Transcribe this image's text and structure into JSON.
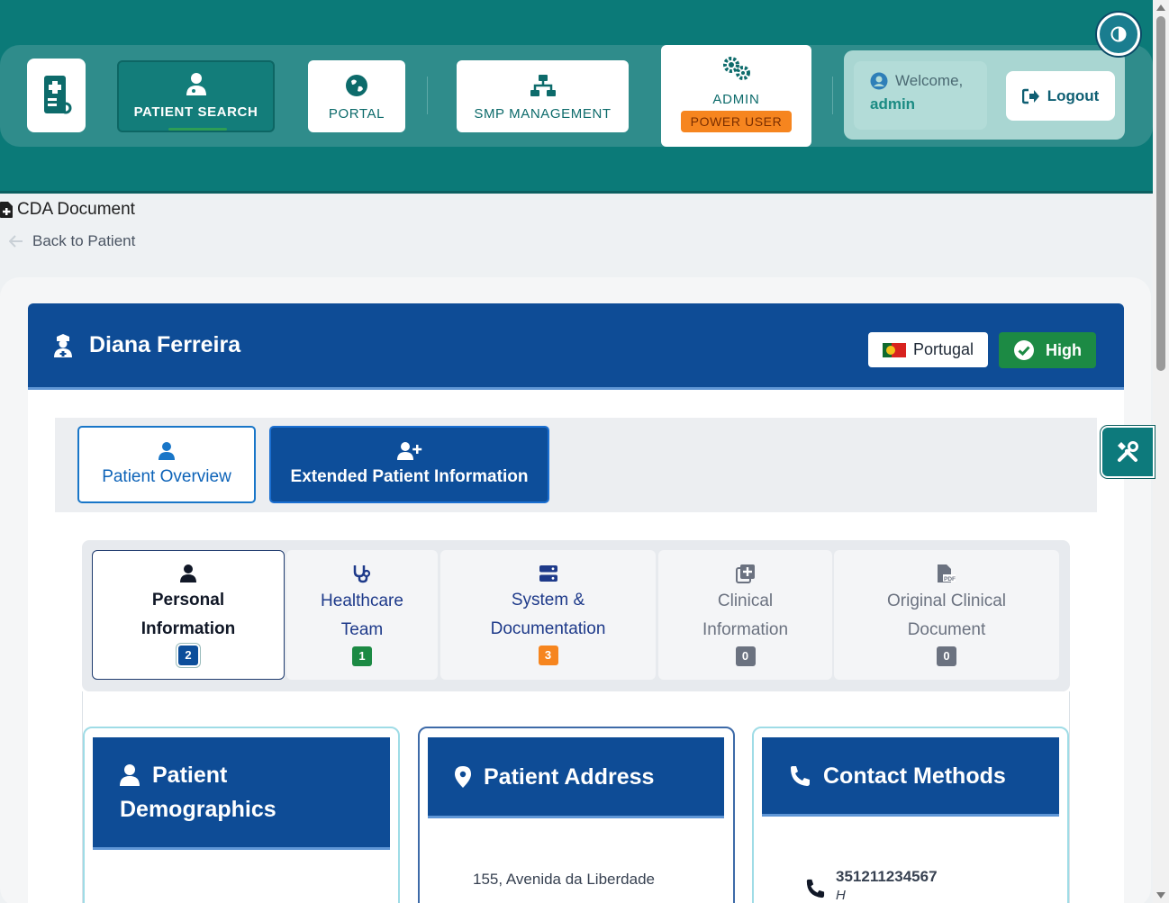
{
  "nav": {
    "logo_icon": "medical-file-icon",
    "items": [
      {
        "label": "PATIENT SEARCH",
        "icon": "user-doctor-icon"
      },
      {
        "label": "PORTAL",
        "icon": "globe-icon"
      },
      {
        "label": "SMP MANAGEMENT",
        "icon": "sitemap-icon"
      }
    ],
    "admin": {
      "label": "ADMIN",
      "role_badge": "POWER USER",
      "icon": "gears-icon"
    },
    "user": {
      "welcome": "Welcome,",
      "name": "admin"
    },
    "logout_label": "Logout"
  },
  "breadcrumb": {
    "title": "CDA Document",
    "back_label": "Back to Patient"
  },
  "patient": {
    "name": "Diana Ferreira",
    "country": "Portugal",
    "quality": "High"
  },
  "view_tabs": [
    {
      "label": "Patient Overview",
      "icon": "user-icon"
    },
    {
      "label": "Extended Patient Information",
      "icon": "user-plus-icon"
    }
  ],
  "sections": [
    {
      "line1": "Personal",
      "line2": "Information",
      "count": "2",
      "icon": "user-icon"
    },
    {
      "line1": "Healthcare",
      "line2": "Team",
      "count": "1",
      "icon": "stethoscope-icon"
    },
    {
      "line1": "System &",
      "line2": "Documentation",
      "count": "3",
      "icon": "server-icon"
    },
    {
      "line1": "Clinical",
      "line2": "Information",
      "count": "0",
      "icon": "notes-medical-icon"
    },
    {
      "line1": "Original Clinical",
      "line2": "Document",
      "count": "0",
      "icon": "file-pdf-icon"
    }
  ],
  "cards": {
    "demographics": {
      "title_line1": "Patient",
      "title_line2": "Demographics"
    },
    "address": {
      "title": "Patient Address",
      "line1": "155, Avenida da Liberdade"
    },
    "contact": {
      "title": "Contact Methods",
      "phone": "351211234567",
      "phone_type": "H"
    }
  },
  "colors": {
    "header_teal": "#0b7a78",
    "primary_blue": "#0e4c96",
    "accent_orange": "#f6851f",
    "success_green": "#1c8a44"
  }
}
